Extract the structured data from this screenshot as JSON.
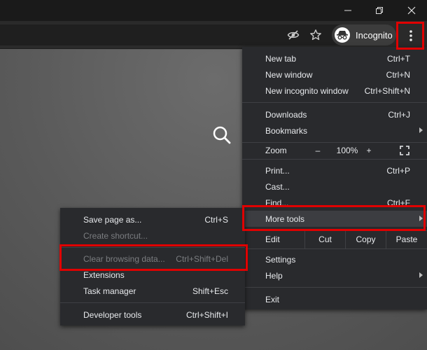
{
  "window": {
    "minimize_icon": "minimize-icon",
    "restore_icon": "restore-icon",
    "close_icon": "close-icon"
  },
  "toolbar": {
    "incognito_label": "Incognito",
    "icons": [
      "eye-off-icon",
      "star-icon",
      "incognito-icon",
      "kebab-menu-icon"
    ]
  },
  "page": {
    "search_icon": "search-icon"
  },
  "main_menu": {
    "new_tab": {
      "label": "New tab",
      "shortcut": "Ctrl+T"
    },
    "new_window": {
      "label": "New window",
      "shortcut": "Ctrl+N"
    },
    "new_incognito": {
      "label": "New incognito window",
      "shortcut": "Ctrl+Shift+N"
    },
    "downloads": {
      "label": "Downloads",
      "shortcut": "Ctrl+J"
    },
    "bookmarks": {
      "label": "Bookmarks"
    },
    "zoom": {
      "label": "Zoom",
      "minus": "–",
      "value": "100%",
      "plus": "+"
    },
    "print": {
      "label": "Print...",
      "shortcut": "Ctrl+P"
    },
    "cast": {
      "label": "Cast..."
    },
    "find": {
      "label": "Find...",
      "shortcut": "Ctrl+F"
    },
    "more_tools": {
      "label": "More tools"
    },
    "edit": {
      "label": "Edit",
      "cut": "Cut",
      "copy": "Copy",
      "paste": "Paste"
    },
    "settings": {
      "label": "Settings"
    },
    "help": {
      "label": "Help"
    },
    "exit": {
      "label": "Exit"
    }
  },
  "sub_menu": {
    "save_page": {
      "label": "Save page as...",
      "shortcut": "Ctrl+S"
    },
    "create_shortcut": {
      "label": "Create shortcut..."
    },
    "clear_data": {
      "label": "Clear browsing data...",
      "shortcut": "Ctrl+Shift+Del"
    },
    "extensions": {
      "label": "Extensions"
    },
    "task_manager": {
      "label": "Task manager",
      "shortcut": "Shift+Esc"
    },
    "dev_tools": {
      "label": "Developer tools",
      "shortcut": "Ctrl+Shift+I"
    }
  },
  "colors": {
    "menu_bg": "#292a2d",
    "highlight": "#e00000",
    "titlebar": "#1a1a1a"
  }
}
